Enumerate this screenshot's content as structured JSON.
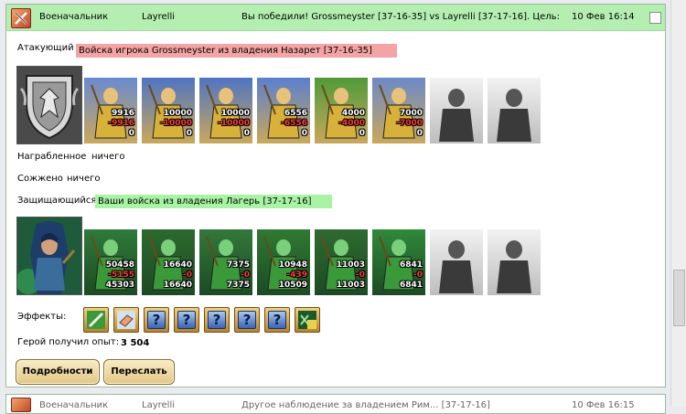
{
  "colors": {
    "header_bg": "#b4efb1",
    "attacker_tag": "#f4a4a4",
    "defender_tag": "#a9f4a4",
    "loss": "#ff3a3a"
  },
  "report": {
    "type_label": "Военачальник",
    "player": "Layrelli",
    "summary": "Вы победили! Grossmeyster [37-16-35] vs Layrelli [37-17-16]. Цель: ...",
    "date": "10 Фев 16:14"
  },
  "attacker": {
    "label": "Атакующий",
    "troops_label": "Войска игрока Grossmeyster из владения Назарет [37-16-35]",
    "hero_icon": "knight-shield-emblem",
    "units": [
      {
        "icon": "crossbowman-icon",
        "count": "9916",
        "loss": "-9916",
        "remain": "0"
      },
      {
        "icon": "cavalry-knight-icon",
        "count": "10000",
        "loss": "-10000",
        "remain": "0"
      },
      {
        "icon": "cavalry-knight-icon",
        "count": "10000",
        "loss": "-10000",
        "remain": "0"
      },
      {
        "icon": "griffin-rider-icon",
        "count": "6556",
        "loss": "-6556",
        "remain": "0"
      },
      {
        "icon": "archer-icon",
        "count": "4000",
        "loss": "-4000",
        "remain": "0"
      },
      {
        "icon": "monk-icon",
        "count": "7000",
        "loss": "-7000",
        "remain": "0"
      },
      {
        "icon": "empty-slot-icon"
      },
      {
        "icon": "empty-slot-icon"
      }
    ]
  },
  "rewards": {
    "label": "Награбленное",
    "value": "ничего"
  },
  "burned": {
    "label": "Сожжено",
    "value": "ничего"
  },
  "defender": {
    "label": "Защищающийся",
    "troops_label": "Ваши войска из владения Лагерь [37-17-16]",
    "hero_icon": "elf-ranger-portrait",
    "units": [
      {
        "icon": "elf-archer-icon",
        "count": "50458",
        "loss": "-5155",
        "remain": "45303"
      },
      {
        "icon": "elf-warrior-icon",
        "count": "16640",
        "loss": "-0",
        "remain": "16640"
      },
      {
        "icon": "elf-spearman-icon",
        "count": "7375",
        "loss": "-0",
        "remain": "7375"
      },
      {
        "icon": "elf-griffin-icon",
        "count": "10948",
        "loss": "-439",
        "remain": "10509"
      },
      {
        "icon": "elf-bowman-icon",
        "count": "11003",
        "loss": "-0",
        "remain": "11003"
      },
      {
        "icon": "elf-druid-icon",
        "count": "6841",
        "loss": "-0",
        "remain": "6841"
      },
      {
        "icon": "empty-slot-icon"
      },
      {
        "icon": "empty-slot-icon"
      }
    ]
  },
  "effects": {
    "label": "Эффекты:",
    "items": [
      "sword-icon",
      "hand-icon",
      "question-icon",
      "question-icon",
      "question-icon",
      "question-icon",
      "question-icon",
      "xp-bonus-icon"
    ]
  },
  "experience": {
    "label": "Герой получил опыт:",
    "value": "3 504"
  },
  "buttons": {
    "details": "Подробности",
    "forward": "Переслать"
  },
  "next_report": {
    "type_label": "Военачальник",
    "player": "Layrelli",
    "summary": "Другое наблюдение за владением Рим... [37-17-16]",
    "date": "10 Фев 16:15"
  }
}
